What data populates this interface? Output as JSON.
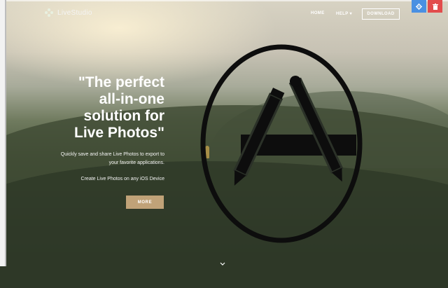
{
  "nav": {
    "logo_text": "LiveStudio",
    "help_label": "HELP",
    "home_label": "HOME",
    "download_label": "DOWNLOAD"
  },
  "hero": {
    "headline_lines": [
      "\"The perfect",
      "all-in-one",
      "solution for",
      "Live Photos\""
    ],
    "subtitle_line1": "Quickly save and share Live Photos to export to",
    "subtitle_line2": "your favorite applications.",
    "subtitle2": "Create Live Photos on any iOS Device",
    "more_label": "MORE"
  },
  "icons": {
    "settings": "gear-icon",
    "delete": "trash-icon",
    "app_store": "app-store-icon",
    "scroll_down": "chevron-down-icon"
  },
  "colors": {
    "accent_button": "#c0a278",
    "settings_bg": "#4a90e2",
    "delete_bg": "#e24c4c"
  }
}
